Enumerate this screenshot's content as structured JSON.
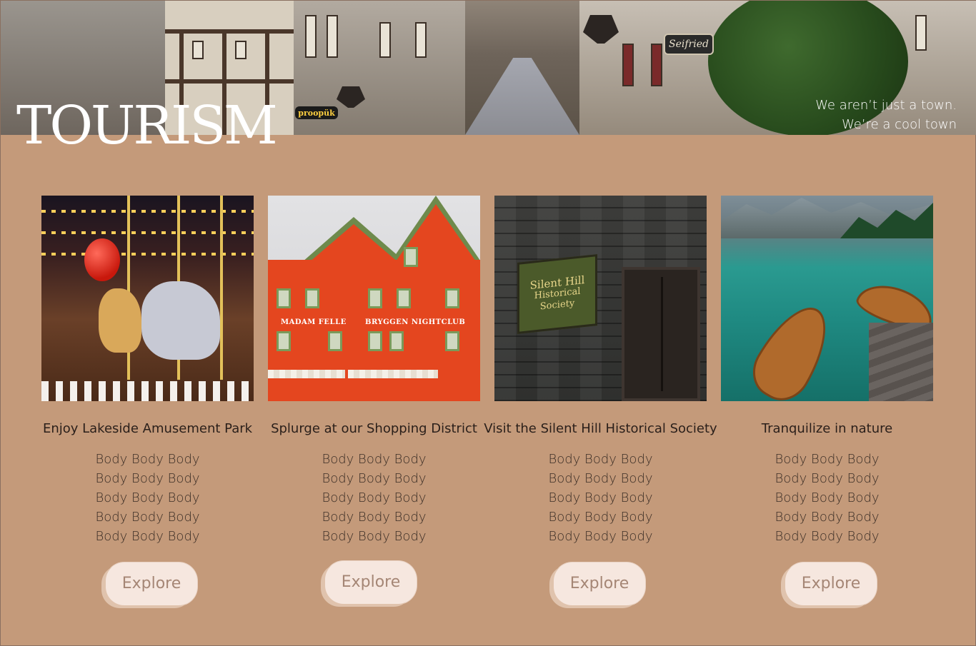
{
  "header": {
    "logo_text": "TOURISM",
    "tagline_line1": "We aren’t just a town.",
    "tagline_line2": "We’re a cool town",
    "sign_text": "Seifried",
    "shop_text": "proopük"
  },
  "cards": [
    {
      "title": "Enjoy Lakeside Amusement Park",
      "body": [
        "Body Body Body",
        "Body Body Body",
        "Body Body Body",
        "Body Body Body",
        "Body Body Body"
      ],
      "button": "Explore"
    },
    {
      "title": "Splurge at our Shopping District",
      "body": [
        "Body Body Body",
        "Body Body Body",
        "Body Body Body",
        "Body Body Body",
        "Body Body Body"
      ],
      "button": "Explore",
      "photo_labels": [
        "MADAM FELLE",
        "BRYGGEN NIGHTCLUB"
      ]
    },
    {
      "title": "Visit the Silent Hill Historical Society",
      "body": [
        "Body Body Body",
        "Body Body Body",
        "Body Body Body",
        "Body Body Body",
        "Body Body Body"
      ],
      "button": "Explore",
      "photo_labels": [
        "Silent Hill",
        "Historical",
        "Society"
      ]
    },
    {
      "title": "Tranquilize in nature",
      "body": [
        "Body Body Body",
        "Body Body Body",
        "Body Body Body",
        "Body Body Body",
        "Body Body Body"
      ],
      "button": "Explore"
    }
  ],
  "colors": {
    "background": "#c49a7a",
    "button_bg": "#f6e7df",
    "button_text": "#a58675"
  }
}
